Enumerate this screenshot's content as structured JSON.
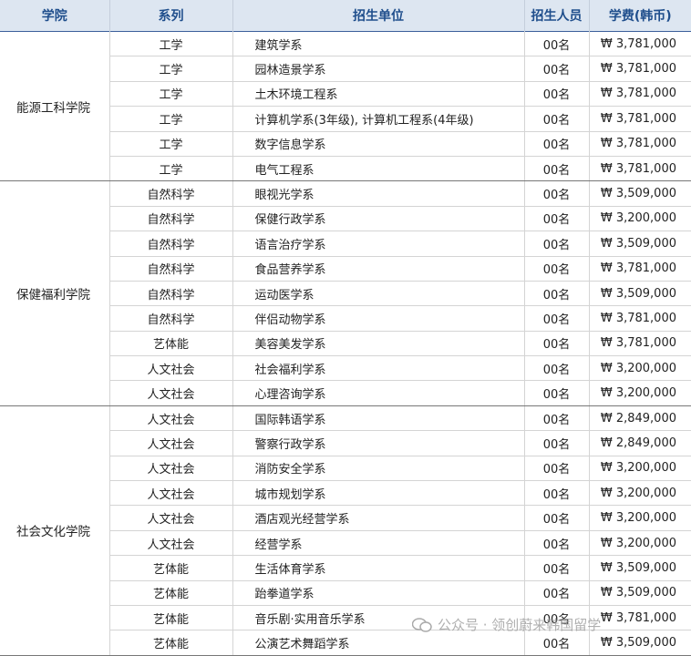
{
  "header": {
    "college": "学院",
    "dept": "系列",
    "unit": "招生单位",
    "count": "招生人员",
    "fee": "学费(韩币)"
  },
  "groups": [
    {
      "college": "能源工科学院",
      "rows": [
        {
          "dept": "工学",
          "unit": "建筑学系",
          "count": "00名",
          "fee": "₩ 3,781,000"
        },
        {
          "dept": "工学",
          "unit": "园林造景学系",
          "count": "00名",
          "fee": "₩ 3,781,000"
        },
        {
          "dept": "工学",
          "unit": "土木环境工程系",
          "count": "00名",
          "fee": "₩ 3,781,000"
        },
        {
          "dept": "工学",
          "unit": "计算机学系(3年级), 计算机工程系(4年级)",
          "count": "00名",
          "fee": "₩ 3,781,000"
        },
        {
          "dept": "工学",
          "unit": "数字信息学系",
          "count": "00名",
          "fee": "₩ 3,781,000"
        },
        {
          "dept": "工学",
          "unit": "电气工程系",
          "count": "00名",
          "fee": "₩ 3,781,000"
        }
      ]
    },
    {
      "college": "保健福利学院",
      "rows": [
        {
          "dept": "自然科学",
          "unit": "眼视光学系",
          "count": "00名",
          "fee": "₩ 3,509,000"
        },
        {
          "dept": "自然科学",
          "unit": "保健行政学系",
          "count": "00名",
          "fee": "₩ 3,200,000"
        },
        {
          "dept": "自然科学",
          "unit": "语言治疗学系",
          "count": "00名",
          "fee": "₩ 3,509,000"
        },
        {
          "dept": "自然科学",
          "unit": "食品营养学系",
          "count": "00名",
          "fee": "₩ 3,781,000"
        },
        {
          "dept": "自然科学",
          "unit": "运动医学系",
          "count": "00名",
          "fee": "₩ 3,509,000"
        },
        {
          "dept": "自然科学",
          "unit": "伴侣动物学系",
          "count": "00名",
          "fee": "₩ 3,781,000"
        },
        {
          "dept": "艺体能",
          "unit": "美容美发学系",
          "count": "00名",
          "fee": "₩ 3,781,000"
        },
        {
          "dept": "人文社会",
          "unit": "社会福利学系",
          "count": "00名",
          "fee": "₩ 3,200,000"
        },
        {
          "dept": "人文社会",
          "unit": "心理咨询学系",
          "count": "00名",
          "fee": "₩ 3,200,000"
        }
      ]
    },
    {
      "college": "社会文化学院",
      "rows": [
        {
          "dept": "人文社会",
          "unit": "国际韩语学系",
          "count": "00名",
          "fee": "₩ 2,849,000"
        },
        {
          "dept": "人文社会",
          "unit": "警察行政学系",
          "count": "00名",
          "fee": "₩ 2,849,000"
        },
        {
          "dept": "人文社会",
          "unit": "消防安全学系",
          "count": "00名",
          "fee": "₩ 3,200,000"
        },
        {
          "dept": "人文社会",
          "unit": "城市规划学系",
          "count": "00名",
          "fee": "₩ 3,200,000"
        },
        {
          "dept": "人文社会",
          "unit": "酒店观光经营学系",
          "count": "00名",
          "fee": "₩ 3,200,000"
        },
        {
          "dept": "人文社会",
          "unit": "经营学系",
          "count": "00名",
          "fee": "₩ 3,200,000"
        },
        {
          "dept": "艺体能",
          "unit": "生活体育学系",
          "count": "00名",
          "fee": "₩ 3,509,000"
        },
        {
          "dept": "艺体能",
          "unit": "跆拳道学系",
          "count": "00名",
          "fee": "₩ 3,509,000"
        },
        {
          "dept": "艺体能",
          "unit": "音乐剧·实用音乐学系",
          "count": "00名",
          "fee": "₩ 3,781,000"
        },
        {
          "dept": "艺体能",
          "unit": "公演艺术舞蹈学系",
          "count": "00名",
          "fee": "₩ 3,509,000"
        }
      ]
    }
  ],
  "watermark": {
    "text": "公众号 · 领创蔚来韩国留学",
    "icon": "wechat-icon"
  }
}
